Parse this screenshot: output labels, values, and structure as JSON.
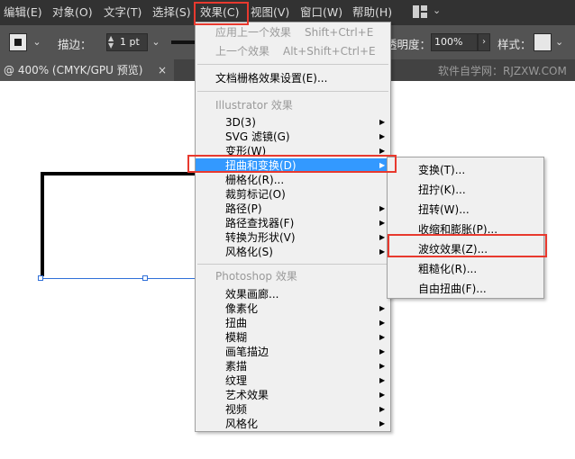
{
  "menubar": {
    "items": [
      "编辑(E)",
      "对象(O)",
      "文字(T)",
      "选择(S)",
      "效果(C)",
      "视图(V)",
      "窗口(W)",
      "帮助(H)"
    ],
    "workspace_icon": "grid-icon",
    "chevron": "⌄"
  },
  "control_bar": {
    "stroke_label": "描边：",
    "stroke_weight": "1 pt",
    "opacity_label": "透明度：",
    "opacity_value": "100%",
    "opacity_button": "›",
    "style_label": "样式：",
    "dropdown_arrow": "⌄",
    "spin_up": "▲",
    "spin_down": "▼"
  },
  "tab": {
    "title": "@ 400% (CMYK/GPU 预览)",
    "close": "×",
    "watermark": "软件自学网：RJZXW.COM"
  },
  "effect_menu": {
    "apply_last": "应用上一个效果",
    "apply_last_shortcut": "Shift+Ctrl+E",
    "last_effect": "上一个效果",
    "last_effect_shortcut": "Alt+Shift+Ctrl+E",
    "raster_settings": "文档栅格效果设置(E)...",
    "illustrator_header": "Illustrator 效果",
    "illustrator_items": [
      "3D(3)",
      "SVG 滤镜(G)",
      "变形(W)",
      "扭曲和变换(D)",
      "栅格化(R)...",
      "裁剪标记(O)",
      "路径(P)",
      "路径查找器(F)",
      "转换为形状(V)",
      "风格化(S)"
    ],
    "illustrator_arrows": [
      true,
      true,
      true,
      true,
      false,
      false,
      true,
      true,
      true,
      true
    ],
    "photoshop_header": "Photoshop 效果",
    "photoshop_items": [
      "效果画廊...",
      "像素化",
      "扭曲",
      "模糊",
      "画笔描边",
      "素描",
      "纹理",
      "艺术效果",
      "视频",
      "风格化"
    ],
    "photoshop_arrows": [
      false,
      true,
      true,
      true,
      true,
      true,
      true,
      true,
      true,
      true
    ],
    "submenu_arrow": "▶"
  },
  "distort_submenu": {
    "items": [
      "变换(T)...",
      "扭拧(K)...",
      "扭转(W)...",
      "收缩和膨胀(P)...",
      "波纹效果(Z)...",
      "粗糙化(R)...",
      "自由扭曲(F)..."
    ]
  },
  "colors": {
    "highlight": "#3399ff",
    "annotation": "#e8392e",
    "menubar_bg": "#323232",
    "control_bg": "#535353"
  }
}
